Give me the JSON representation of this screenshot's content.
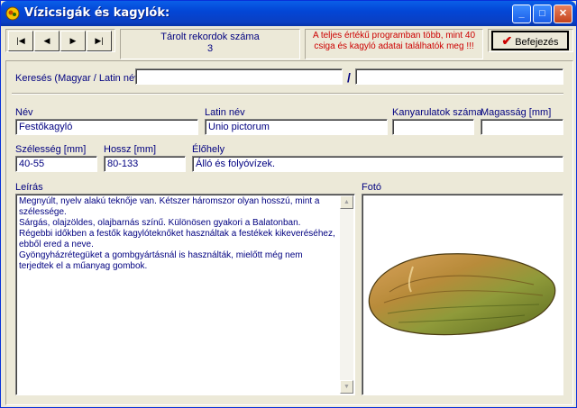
{
  "window": {
    "title": "Vízicsigák és kagylók:"
  },
  "titlebar_buttons": {
    "minimize": "_",
    "maximize": "□",
    "close": "✕"
  },
  "nav": {
    "first": "|◀",
    "prev": "◀",
    "next": "▶",
    "last": "▶|"
  },
  "records": {
    "label": "Tárolt rekordok száma",
    "count": "3"
  },
  "info": {
    "text": "A teljes értékű programban több, mint 40 csiga és kagyló adatai találhatók meg !!!"
  },
  "exit_button": {
    "label": "Befejezés"
  },
  "search": {
    "label": "Keresés (Magyar / Latin név):",
    "hungarian_value": "",
    "latin_value": "",
    "separator": "/"
  },
  "fields": {
    "name_label": "Név",
    "name_value": "Festőkagyló",
    "latin_label": "Latin név",
    "latin_value": "Unio pictorum",
    "whorls_label": "Kanyarulatok száma",
    "whorls_value": "",
    "height_label": "Magasság [mm]",
    "height_value": "",
    "width_label": "Szélesség [mm]",
    "width_value": "40-55",
    "length_label": "Hossz [mm]",
    "length_value": "80-133",
    "habitat_label": "Élőhely",
    "habitat_value": "Álló és folyóvízek."
  },
  "description": {
    "label": "Leírás",
    "text": "Megnyúlt, nyelv alakú teknője van. Kétszer háromszor olyan hosszú, mint a szélessége.\nSárgás, olajzöldes, olajbarnás színű. Különösen gyakori a Balatonban.\nRégebbi időkben a festők kagylóteknőket használtak a festékek kikeveréséhez, ebből ered a neve.\nGyöngyházrétegüket a gombgyártásnál is használták, mielőtt még nem terjedtek el a műanyag gombok."
  },
  "photo": {
    "label": "Fotó",
    "image": "mussel-shell-image"
  },
  "colors": {
    "accent_text": "#000080",
    "info_text": "#cc0000",
    "titlebar": "#0a5fe8"
  }
}
